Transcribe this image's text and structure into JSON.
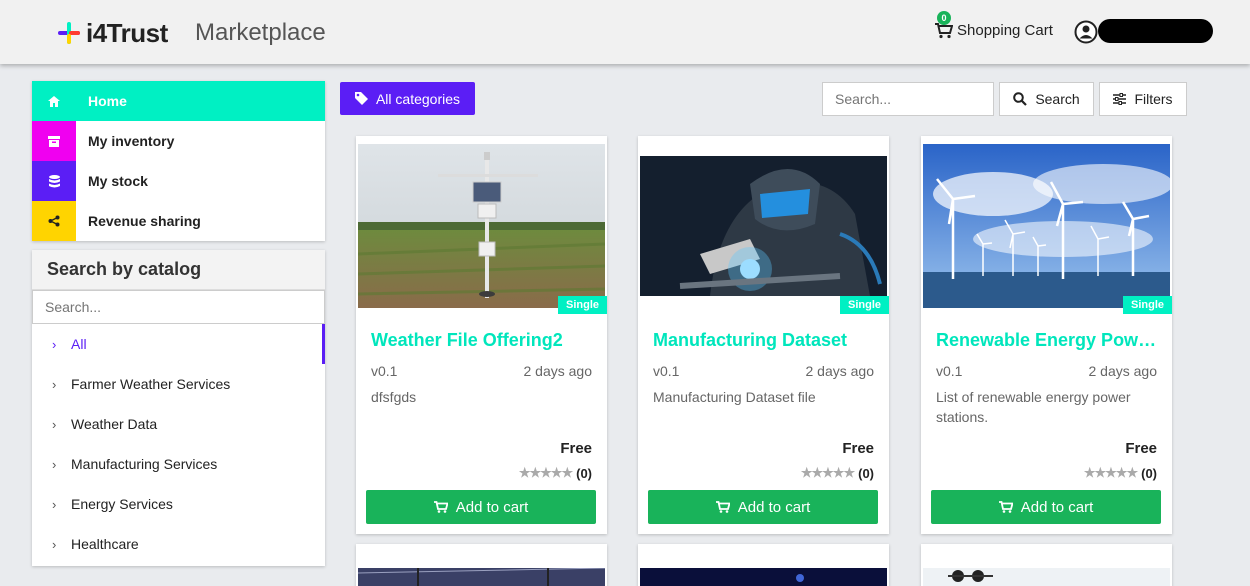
{
  "header": {
    "logo_text": "i4Trust",
    "app_title": "Marketplace",
    "cart_label": "Shopping Cart",
    "cart_count": "0",
    "user_name": ""
  },
  "nav": {
    "items": [
      {
        "label": "Home",
        "icon": "home-icon",
        "color": "#00f0c3"
      },
      {
        "label": "My inventory",
        "icon": "archive-icon",
        "color": "#f000f0"
      },
      {
        "label": "My stock",
        "icon": "database-icon",
        "color": "#5b1ef5"
      },
      {
        "label": "Revenue sharing",
        "icon": "share-icon",
        "color": "#ffd400"
      }
    ]
  },
  "catalog": {
    "title": "Search by catalog",
    "search_placeholder": "Search...",
    "items": [
      "All",
      "Farmer Weather Services",
      "Weather Data",
      "Manufacturing Services",
      "Energy Services",
      "Healthcare"
    ]
  },
  "toolbar": {
    "all_categories_label": "All categories",
    "search_placeholder": "Search...",
    "search_label": "Search",
    "filters_label": "Filters"
  },
  "offerings": [
    {
      "title": "Weather File Offering2",
      "version": "v0.1",
      "date": "2 days ago",
      "description": "dfsfgds",
      "price": "Free",
      "rating": "(0)",
      "tag": "Single",
      "button": "Add to cart"
    },
    {
      "title": "Manufacturing Dataset",
      "version": "v0.1",
      "date": "2 days ago",
      "description": "Manufacturing Dataset file",
      "price": "Free",
      "rating": "(0)",
      "tag": "Single",
      "button": "Add to cart"
    },
    {
      "title": "Renewable Energy Power Stations",
      "version": "v0.1",
      "date": "2 days ago",
      "description": "List of renewable energy power stations.",
      "price": "Free",
      "rating": "(0)",
      "tag": "Single",
      "button": "Add to cart"
    }
  ],
  "colors": {
    "accent": "#00f0c3",
    "primary": "#5b1ef5",
    "success": "#19b35a"
  }
}
